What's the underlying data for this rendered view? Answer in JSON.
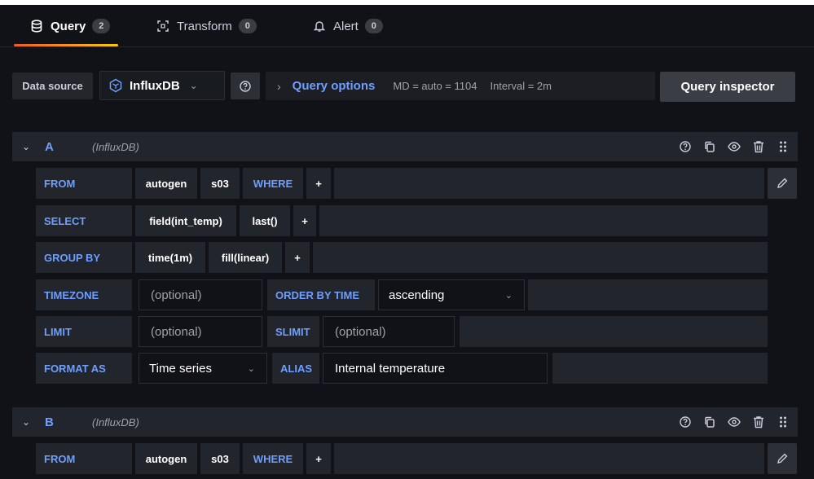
{
  "tabs": [
    {
      "label": "Query",
      "count": "2",
      "icon": "database-icon"
    },
    {
      "label": "Transform",
      "count": "0",
      "icon": "transform-icon"
    },
    {
      "label": "Alert",
      "count": "0",
      "icon": "bell-icon"
    }
  ],
  "toolbar": {
    "data_source_label": "Data source",
    "data_source_name": "InfluxDB",
    "query_options_label": "Query options",
    "md_text": "MD = auto = 1104",
    "interval_text": "Interval = 2m",
    "query_inspector_label": "Query inspector"
  },
  "queries": [
    {
      "letter": "A",
      "datasource": "(InfluxDB)",
      "from": {
        "keyword": "FROM",
        "policy": "autogen",
        "measurement": "s03",
        "where": "WHERE",
        "plus": "+"
      },
      "select": {
        "keyword": "SELECT",
        "field": "field(int_temp)",
        "func": "last()",
        "plus": "+"
      },
      "group_by": {
        "keyword": "GROUP BY",
        "time": "time(1m)",
        "fill": "fill(linear)",
        "plus": "+"
      },
      "timezone": {
        "keyword": "TIMEZONE",
        "placeholder": "(optional)",
        "order_keyword": "ORDER BY TIME",
        "order_value": "ascending"
      },
      "limit": {
        "keyword": "LIMIT",
        "placeholder": "(optional)",
        "slimit_keyword": "SLIMIT",
        "slimit_placeholder": "(optional)"
      },
      "format": {
        "keyword": "FORMAT AS",
        "value": "Time series",
        "alias_keyword": "ALIAS",
        "alias_value": "Internal temperature"
      }
    },
    {
      "letter": "B",
      "datasource": "(InfluxDB)",
      "from": {
        "keyword": "FROM",
        "policy": "autogen",
        "measurement": "s03",
        "where": "WHERE",
        "plus": "+"
      }
    }
  ],
  "colors": {
    "accent_blue": "#6e9fff",
    "background": "#111217",
    "panel": "#22252b"
  }
}
